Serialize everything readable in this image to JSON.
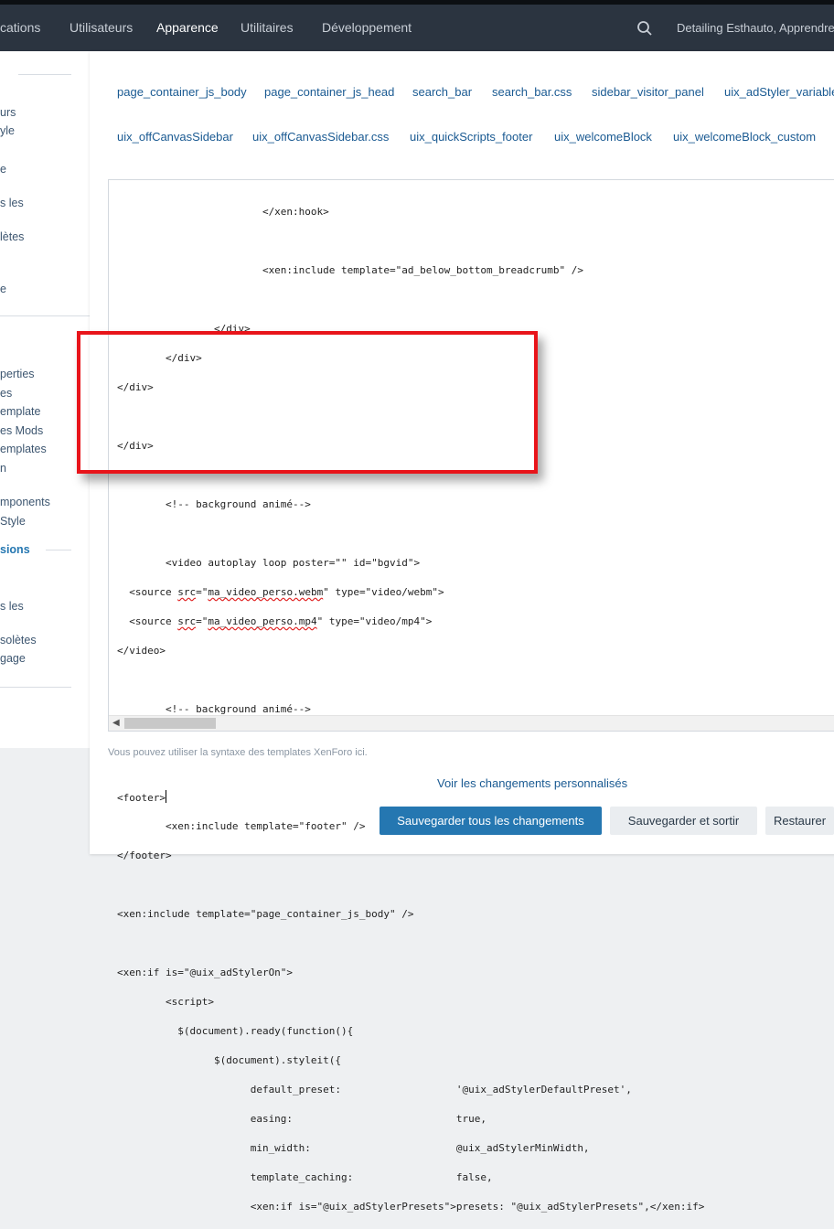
{
  "topnav": {
    "items": [
      "cations",
      "Utilisateurs",
      "Apparence",
      "Utilitaires",
      "Développement"
    ],
    "active": "Apparence",
    "user": "Detailing Esthauto, Apprendre"
  },
  "sidebar": {
    "items": [
      "urs",
      "yle",
      "e",
      "s les",
      "lètes",
      "e",
      "perties",
      "es",
      "emplate",
      "es Mods",
      "emplates",
      "n",
      "mponents",
      "Style",
      "sions",
      "s les",
      "solètes",
      "gage"
    ],
    "active_index": 14
  },
  "templates": {
    "row1": [
      "page_container_js_body",
      "page_container_js_head",
      "search_bar",
      "search_bar.css",
      "sidebar_visitor_panel",
      "uix_adStyler_variables"
    ],
    "row2": [
      "uix_offCanvasSidebar",
      "uix_offCanvasSidebar.css",
      "uix_quickScripts_footer",
      "uix_welcomeBlock",
      "uix_welcomeBlock_custom"
    ]
  },
  "code": {
    "l01": "                        </xen:hook>",
    "l02": "",
    "l03": "                        <xen:include template=\"ad_below_bottom_breadcrumb\" />",
    "l04": "",
    "l05": "                </div>",
    "l06": "        </div>",
    "l07": "</div>",
    "l08": "",
    "l09": "</div>",
    "l10": "",
    "l11": "        <!-- background animé-->",
    "l12": "",
    "l13": "        <video autoplay loop poster=\"\" id=\"bgvid\">",
    "l14a": "  <source ",
    "l14b": "src",
    "l14c": "=\"",
    "l14d": "ma_video_perso.webm",
    "l14e": "\" type=\"video/webm\">",
    "l15a": "  <source ",
    "l15b": "src",
    "l15c": "=\"",
    "l15d": "ma_video_perso.mp4",
    "l15e": "\" type=\"video/mp4\">",
    "l16": "</video>",
    "l17": "",
    "l18": "        <!-- background animé-->",
    "l19": "",
    "l20": "",
    "l21": "<footer>",
    "l22": "        <xen:include template=\"footer\" />",
    "l23": "</footer>",
    "l24": "",
    "l25": "<xen:include template=\"page_container_js_body\" />",
    "l26": "",
    "l27": "<xen:if is=\"@uix_adStylerOn\">",
    "l28": "        <script>",
    "l29": "          $(document).ready(function(){",
    "l30": "                $(document).styleit({",
    "l31": "                      default_preset:                   '@uix_adStylerDefaultPreset',",
    "l32": "                      easing:                           true,",
    "l33": "                      min_width:                        @uix_adStylerMinWidth,",
    "l34": "                      template_caching:                 false,",
    "l35": "                      <xen:if is=\"@uix_adStylerPresets\">presets: \"@uix_adStylerPresets\",</xen:if>"
  },
  "hint": "Vous pouvez utiliser la syntaxe des templates XenForo ici.",
  "view_changes": "Voir les changements personnalisés",
  "buttons": {
    "save_all": "Sauvegarder tous les changements",
    "save_exit": "Sauvegarder et sortir",
    "restore": "Restaurer"
  },
  "colors": {
    "topbar": "#2b3440",
    "accent": "#2577b1",
    "link": "#1a5a92",
    "highlight": "#e8141a"
  }
}
